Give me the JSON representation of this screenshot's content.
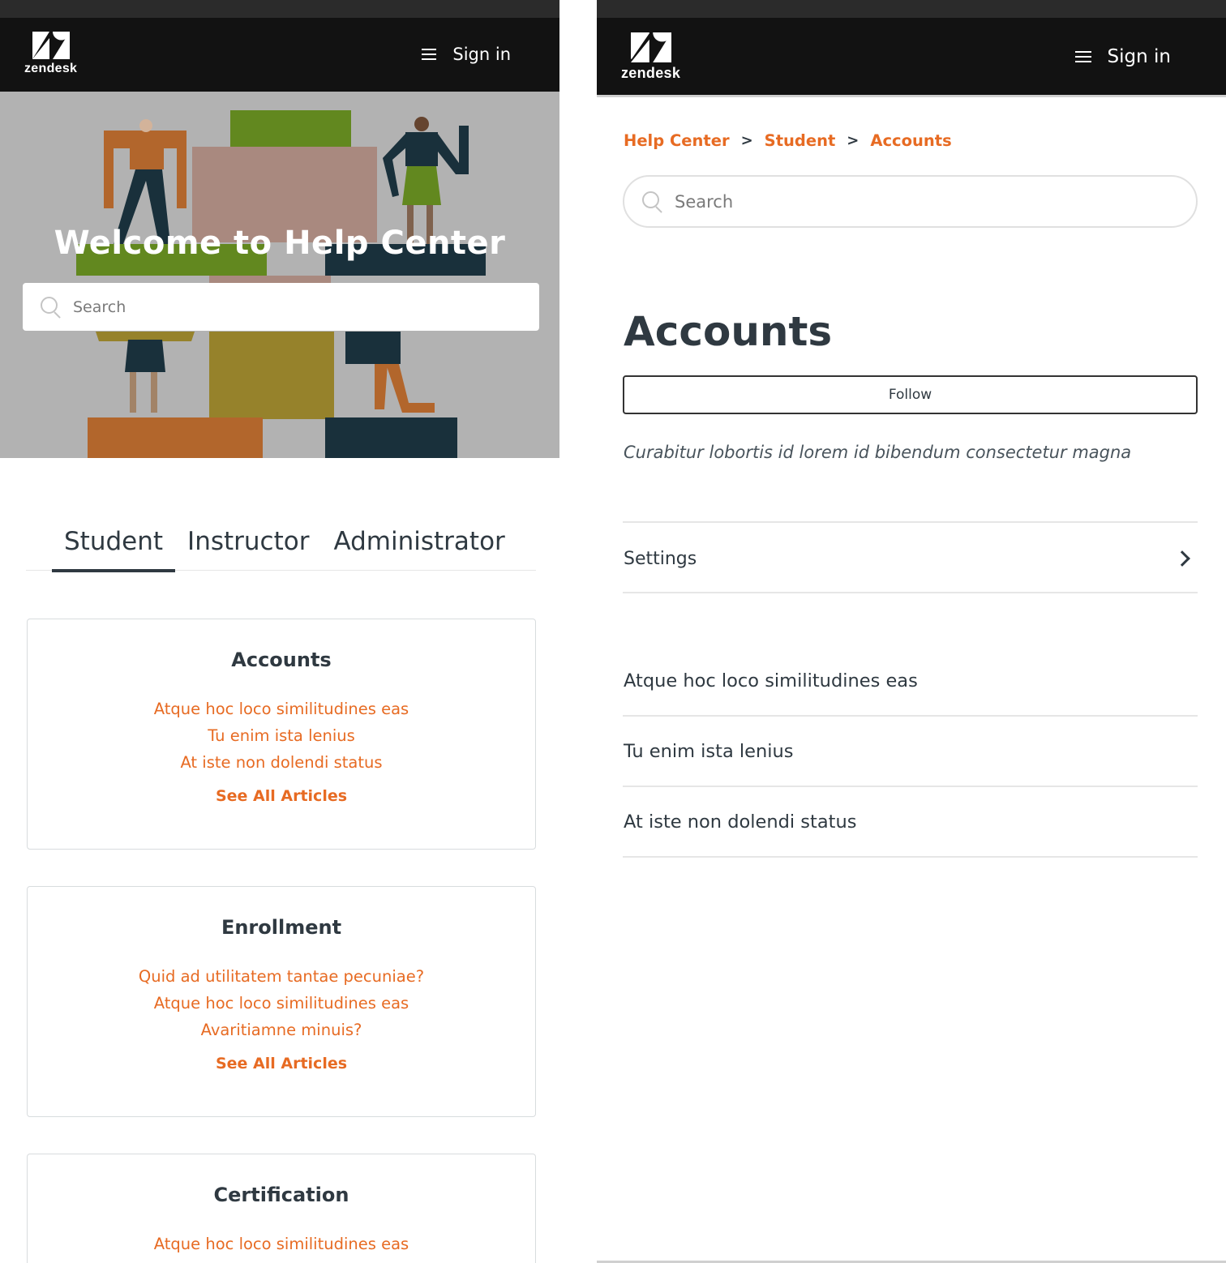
{
  "left_screen": {
    "header": {
      "logo_text": "zendesk",
      "sign_in_label": "Sign in"
    },
    "hero": {
      "title": "Welcome to Help Center",
      "search_placeholder": "Search"
    },
    "tabs": [
      {
        "label": "Student",
        "active": true
      },
      {
        "label": "Instructor",
        "active": false
      },
      {
        "label": "Administrator",
        "active": false
      }
    ],
    "cards": [
      {
        "title": "Accounts",
        "articles": [
          "Atque hoc loco similitudines eas",
          "Tu enim ista lenius",
          "At iste non dolendi status"
        ],
        "see_all": "See All Articles"
      },
      {
        "title": "Enrollment",
        "articles": [
          "Quid ad utilitatem tantae pecuniae?",
          "Atque hoc loco similitudines eas",
          "Avaritiamne minuis?"
        ],
        "see_all": "See All Articles"
      },
      {
        "title": "Certification",
        "articles": [
          "Atque hoc loco similitudines eas"
        ]
      }
    ]
  },
  "right_screen": {
    "header": {
      "logo_text": "zendesk",
      "sign_in_label": "Sign in"
    },
    "breadcrumb": [
      "Help Center",
      "Student",
      "Accounts"
    ],
    "breadcrumb_separator": ">",
    "search_placeholder": "Search",
    "section": {
      "title": "Accounts",
      "follow_label": "Follow",
      "description": "Curabitur lobortis id lorem id bibendum consectetur magna"
    },
    "subsections": [
      {
        "label": "Settings"
      }
    ],
    "articles": [
      "Atque hoc loco similitudines eas",
      "Tu enim ista lenius",
      "At iste non dolendi status"
    ]
  },
  "colors": {
    "brand_accent": "#e76b23",
    "header_bg": "#121212",
    "text_primary": "#2f3941"
  },
  "icons": [
    "zendesk-logo-icon",
    "hamburger-menu-icon",
    "search-icon",
    "chevron-right-icon"
  ]
}
